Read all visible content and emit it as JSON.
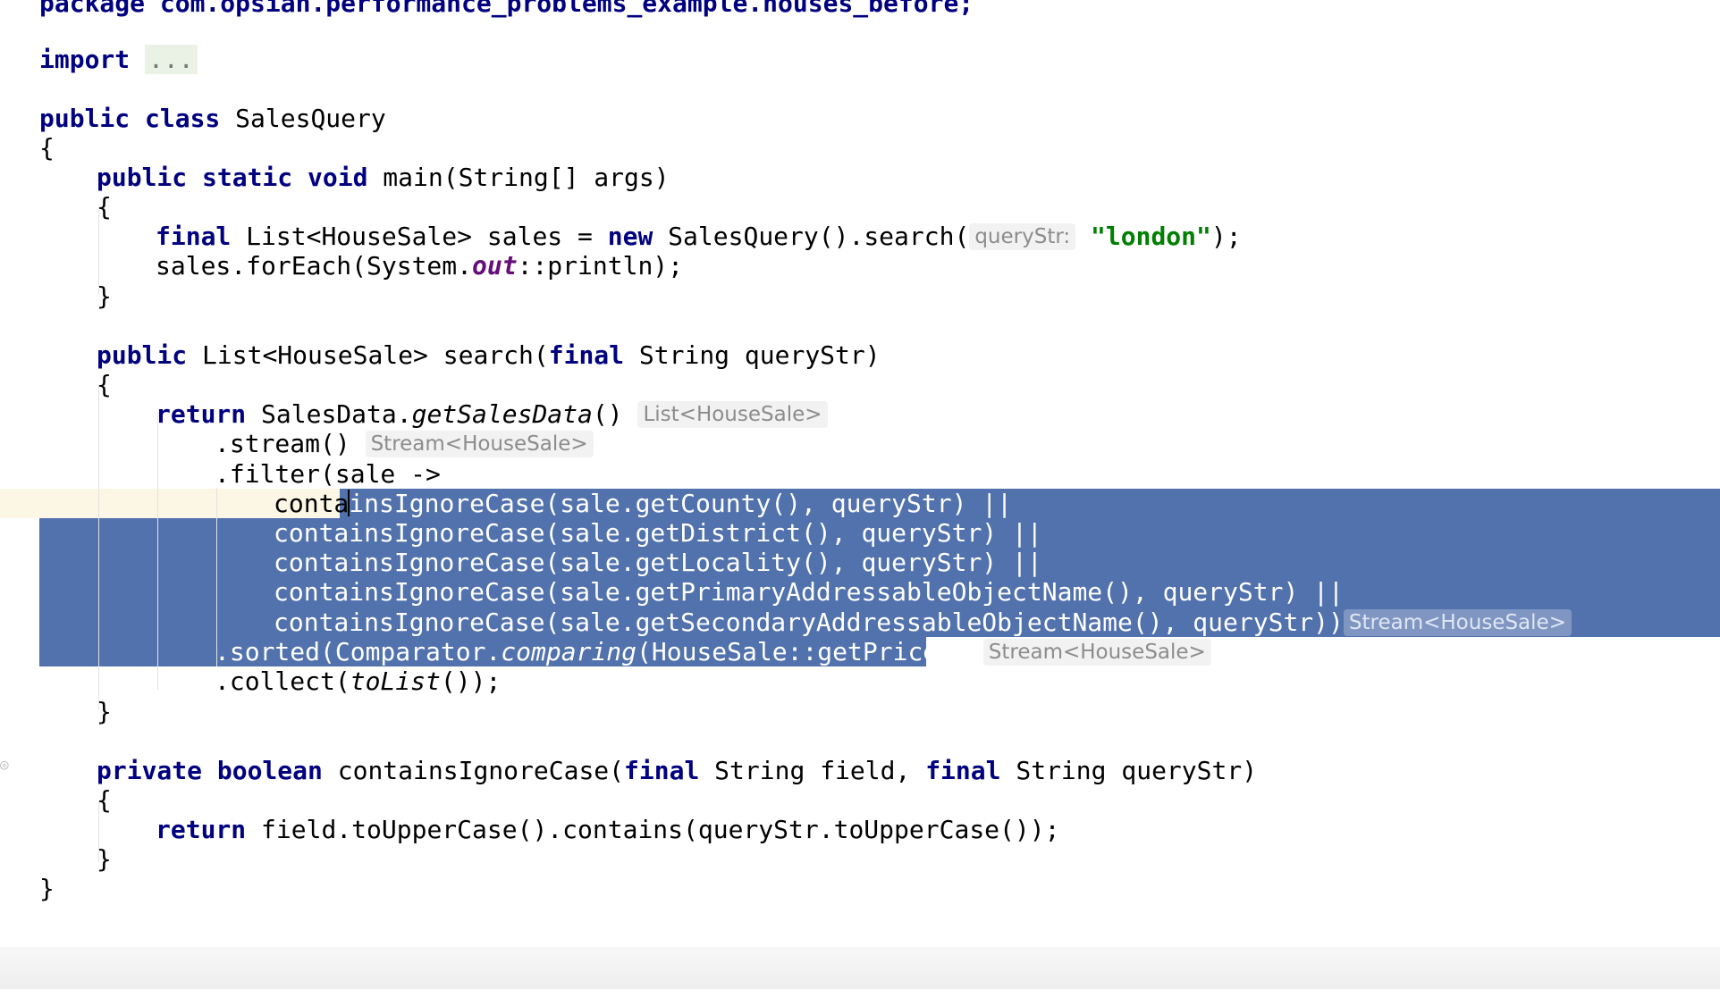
{
  "editor": {
    "package_line": "package com.opsian.performance_problems_example.houses_before;",
    "import_keyword": "import",
    "import_fold": "...",
    "class_decl": {
      "mods": "public class",
      "name": " SalesQuery"
    },
    "brace_open": "{",
    "brace_close": "}",
    "main_decl": {
      "mods": "public static void",
      "rest": " main(String[] args)"
    },
    "final_line": {
      "kw1": "final",
      "mid": " List<HouseSale> sales = ",
      "kw2": "new",
      "call": " SalesQuery().search(",
      "hint": "queryStr:",
      "arg": "\"london\"",
      "end": ");"
    },
    "foreach_line": {
      "pre": "sales.forEach(System.",
      "field": "out",
      "post": "::println);"
    },
    "search_decl": {
      "kw1": "public",
      "mid": " List<HouseSale> search(",
      "kw2": "final",
      "end": " String queryStr)"
    },
    "return_line": {
      "kw": "return",
      "pre": " SalesData.",
      "method": "getSalesData",
      "post": "()",
      "hint": "List<HouseSale>"
    },
    "stream_line": {
      "code": ".stream()",
      "hint": "Stream<HouseSale>"
    },
    "filter_line": ".filter(sale ->",
    "contains_lines": {
      "l1_pre": "conta",
      "l1_sel": "insIgnoreCase(sale.getCounty(), queryStr) ||",
      "l2": "containsIgnoreCase(sale.getDistrict(), queryStr) ||",
      "l3": "containsIgnoreCase(sale.getLocality(), queryStr) ||",
      "l4": "containsIgnoreCase(sale.getPrimaryAddressableObjectName(), queryStr) ||",
      "l5": "containsIgnoreCase(sale.getSecondaryAddressableObjectName(), queryStr))",
      "l5_hint": "Stream<HouseSale>"
    },
    "sorted_line": {
      "pre": ".sorted(Comparator.",
      "method": "comparing",
      "post": "(HouseSale::getPrice))",
      "hint": "Stream<HouseSale>"
    },
    "collect_line": {
      "pre": ".collect(",
      "method": "toList",
      "post": "());"
    },
    "private_decl": {
      "kw1": "private boolean",
      "mid": " containsIgnoreCase(",
      "kw2": "final",
      "mid2": " String field, ",
      "kw3": "final",
      "end": " String queryStr)"
    },
    "return2_line": {
      "kw": "return",
      "rest": " field.toUpperCase().contains(queryStr.toUpperCase());"
    }
  }
}
